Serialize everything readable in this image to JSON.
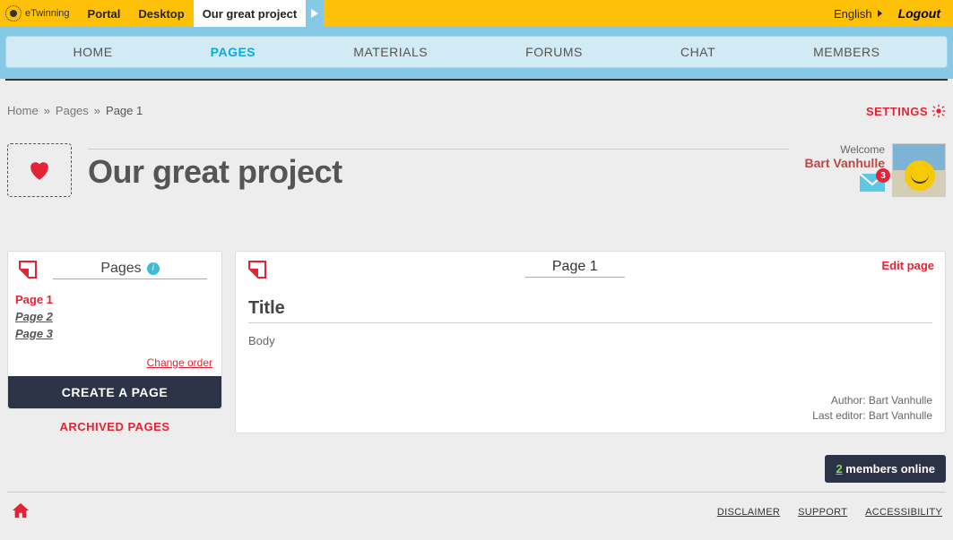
{
  "brand": "eTwinning",
  "topnav": {
    "portal": "Portal",
    "desktop": "Desktop",
    "project": "Our great project"
  },
  "language": "English",
  "logout": "Logout",
  "mainnav": {
    "home": "HOME",
    "pages": "PAGES",
    "materials": "MATERIALS",
    "forums": "FORUMS",
    "chat": "CHAT",
    "members": "MEMBERS"
  },
  "breadcrumbs": {
    "home": "Home",
    "pages": "Pages",
    "current": "Page 1"
  },
  "settings_label": "SETTINGS",
  "project_title": "Our great project",
  "welcome_label": "Welcome",
  "username": "Bart Vanhulle",
  "mail_count": "3",
  "sidebar": {
    "title": "Pages",
    "items": [
      "Page 1",
      "Page 2",
      "Page 3"
    ],
    "change_order": "Change order",
    "create": "CREATE A PAGE",
    "archived": "ARCHIVED PAGES"
  },
  "page": {
    "title": "Page 1",
    "edit": "Edit page",
    "content_title": "Title",
    "content_body": "Body",
    "author_label": "Author: Bart Vanhulle",
    "editor_label": "Last editor: Bart Vanhulle"
  },
  "footer": {
    "online_count": "2",
    "online_label": " members online",
    "disclaimer": "DISCLAIMER",
    "support": "SUPPORT",
    "accessibility": "ACCESSIBILITY"
  }
}
